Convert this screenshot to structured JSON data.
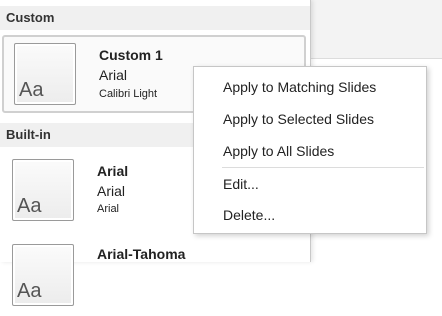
{
  "sections": {
    "custom_header": "Custom",
    "builtin_header": "Built-in"
  },
  "custom_items": [
    {
      "thumb": "Aa",
      "name": "Custom 1",
      "heading_font": "Arial",
      "body_font": "Calibri Light"
    }
  ],
  "builtin_items": [
    {
      "thumb": "Aa",
      "name": "Arial",
      "heading_font": "Arial",
      "body_font": "Arial"
    },
    {
      "thumb": "Aa",
      "name": "Arial-Tahoma",
      "heading_font": "",
      "body_font": ""
    }
  ],
  "context_menu": {
    "apply_matching": "Apply to Matching Slides",
    "apply_selected": "Apply to Selected Slides",
    "apply_all": "Apply to All Slides",
    "edit": "Edit...",
    "delete": "Delete..."
  }
}
